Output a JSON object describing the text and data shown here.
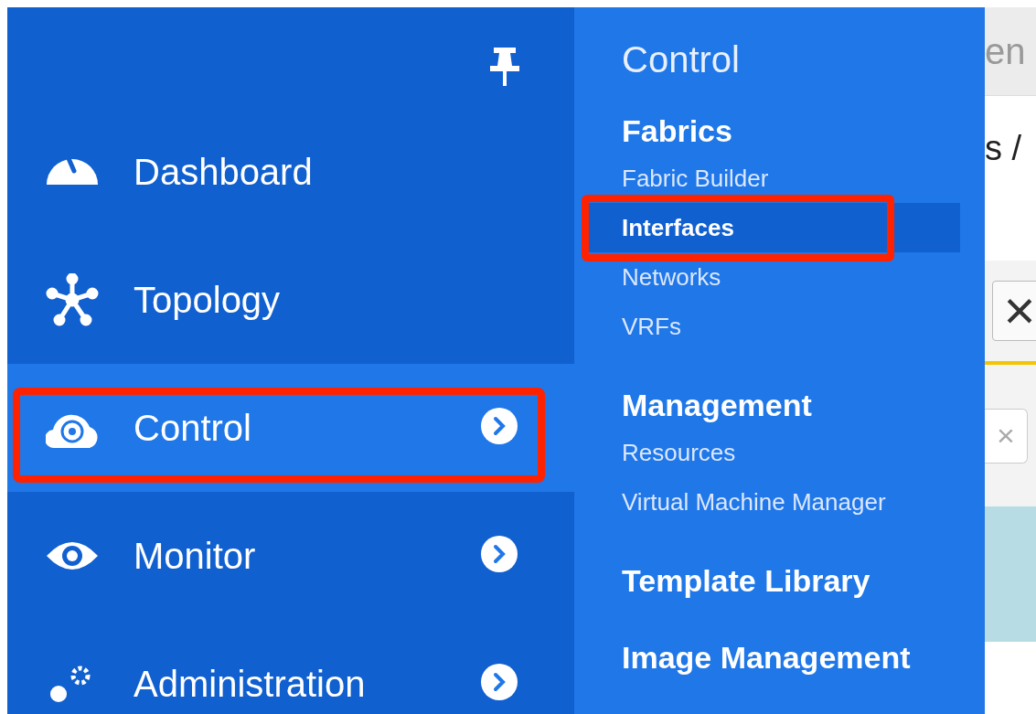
{
  "sidebar": {
    "items": [
      {
        "label": "Dashboard",
        "kind": "gauge",
        "selected": false,
        "has_submenu": false,
        "annotated": false
      },
      {
        "label": "Topology",
        "kind": "topology",
        "selected": false,
        "has_submenu": false,
        "annotated": false
      },
      {
        "label": "Control",
        "kind": "cloud",
        "selected": true,
        "has_submenu": true,
        "annotated": true
      },
      {
        "label": "Monitor",
        "kind": "eye",
        "selected": false,
        "has_submenu": true,
        "annotated": false
      },
      {
        "label": "Administration",
        "kind": "gears",
        "selected": false,
        "has_submenu": true,
        "annotated": false
      }
    ]
  },
  "submenu": {
    "title": "Control",
    "sections": [
      {
        "heading": "Fabrics",
        "items": [
          {
            "label": "Fabric Builder",
            "selected": false,
            "annotated": false
          },
          {
            "label": "Interfaces",
            "selected": true,
            "annotated": true
          },
          {
            "label": "Networks",
            "selected": false,
            "annotated": false
          },
          {
            "label": "VRFs",
            "selected": false,
            "annotated": false
          }
        ]
      },
      {
        "heading": "Management",
        "items": [
          {
            "label": "Resources",
            "selected": false,
            "annotated": false
          },
          {
            "label": "Virtual Machine Manager",
            "selected": false,
            "annotated": false
          }
        ]
      },
      {
        "heading": "Template Library"
      },
      {
        "heading": "Image Management"
      }
    ]
  },
  "background_page": {
    "tab_label": "en",
    "breadcrumb": "s /",
    "close_button": "×",
    "clear_button": "×"
  }
}
